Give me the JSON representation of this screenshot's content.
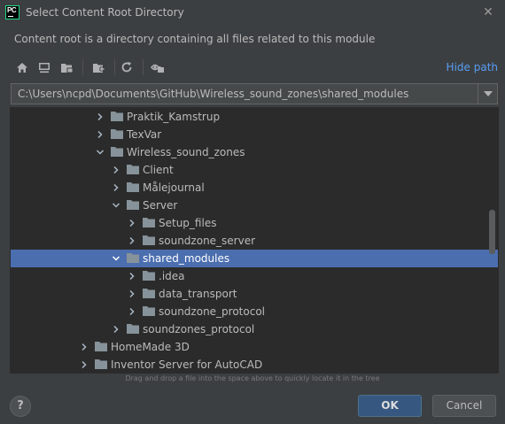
{
  "window": {
    "app_icon_text": "PC",
    "title": "Select Content Root Directory"
  },
  "description": "Content root is a directory containing all files related to this module",
  "toolbar": {
    "buttons": [
      "home-icon",
      "desktop-icon",
      "project-folder-icon",
      "new-folder-icon",
      "refresh-icon",
      "show-hidden-icon"
    ],
    "hide_path_label": "Hide path"
  },
  "path": {
    "value": "C:\\Users\\ncpd\\Documents\\GitHub\\Wireless_sound_zones\\shared_modules"
  },
  "tree": {
    "rows": [
      {
        "label": "Praktik_Kamstrup",
        "depth": 0,
        "expanded": false,
        "selected": false
      },
      {
        "label": "TexVar",
        "depth": 0,
        "expanded": false,
        "selected": false
      },
      {
        "label": "Wireless_sound_zones",
        "depth": 0,
        "expanded": true,
        "selected": false
      },
      {
        "label": "Client",
        "depth": 1,
        "expanded": false,
        "selected": false
      },
      {
        "label": "Målejournal",
        "depth": 1,
        "expanded": false,
        "selected": false
      },
      {
        "label": "Server",
        "depth": 1,
        "expanded": true,
        "selected": false
      },
      {
        "label": "Setup_files",
        "depth": 2,
        "expanded": false,
        "selected": false
      },
      {
        "label": "soundzone_server",
        "depth": 2,
        "expanded": false,
        "selected": false
      },
      {
        "label": "shared_modules",
        "depth": 1,
        "expanded": true,
        "selected": true
      },
      {
        "label": ".idea",
        "depth": 2,
        "expanded": false,
        "selected": false
      },
      {
        "label": "data_transport",
        "depth": 2,
        "expanded": false,
        "selected": false
      },
      {
        "label": "soundzone_protocol",
        "depth": 2,
        "expanded": false,
        "selected": false
      },
      {
        "label": "soundzones_protocol",
        "depth": 1,
        "expanded": false,
        "selected": false
      },
      {
        "label": "HomeMade 3D",
        "depth": -1,
        "expanded": false,
        "selected": false
      },
      {
        "label": "Inventor Server for AutoCAD",
        "depth": -1,
        "expanded": false,
        "selected": false
      }
    ]
  },
  "hint": "Drag and drop a file into the space above to quickly locate it in the tree",
  "buttons": {
    "help": "?",
    "ok": "OK",
    "cancel": "Cancel"
  },
  "colors": {
    "background": "#3c3f41",
    "tree_background": "#2b2b2b",
    "selection": "#4b6eaf",
    "link": "#589df6",
    "folder": "#87939a",
    "ok_button": "#365880"
  }
}
